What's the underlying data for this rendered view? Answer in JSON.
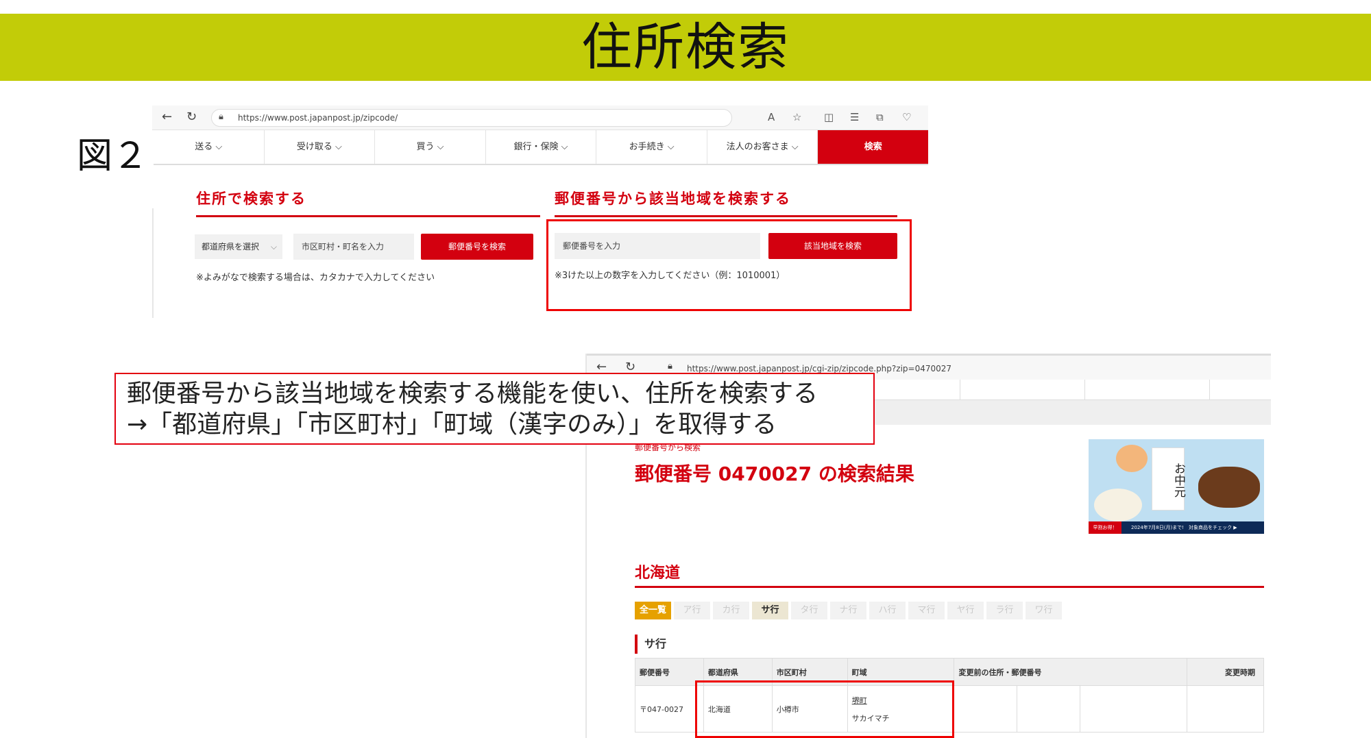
{
  "slide": {
    "title": "住所検索",
    "figure_label": "図２"
  },
  "shot1": {
    "url": "https://www.post.japanpost.jp/zipcode/",
    "nav": [
      "送る ⌵",
      "受け取る ⌵",
      "買う ⌵",
      "銀行・保険 ⌵",
      "お手続き ⌵",
      "法人のお客さま ⌵"
    ],
    "nav_search": "検索",
    "address_section": {
      "title": "住所で検索する",
      "prefecture_select": "都道府県を選択",
      "city_placeholder": "市区町村・町名を入力",
      "button": "郵便番号を検索",
      "note": "※よみがなで検索する場合は、カタカナで入力してください"
    },
    "zip_section": {
      "title": "郵便番号から該当地域を検索する",
      "zip_placeholder": "郵便番号を入力",
      "button": "該当地域を検索",
      "note": "※3けた以上の数字を入力してください（例：1010001）"
    }
  },
  "shot2": {
    "url": "https://www.post.japanpost.jp/cgi-zip/zipcode.php?zip=0470027",
    "breadcrumb": "郵便番号から検索",
    "result_title": "郵便番号 0470027 の検索結果",
    "promo": {
      "card_text": "お中元",
      "strip_left": "早割お得！",
      "strip_text": "2024年7月8日(月)まで!　対象商品をチェック ▶"
    },
    "prefecture_heading": "北海道",
    "kana_tabs": [
      "全一覧",
      "ア行",
      "カ行",
      "サ行",
      "タ行",
      "ナ行",
      "ハ行",
      "マ行",
      "ヤ行",
      "ラ行",
      "ワ行"
    ],
    "active_tab": "サ行",
    "row_group": "サ行",
    "table": {
      "headers": [
        "郵便番号",
        "都道府県",
        "市区町村",
        "町域",
        "変更前の住所・郵便番号",
        "変更時期"
      ],
      "row": {
        "zip": "〒047-0027",
        "prefecture": "北海道",
        "city": "小樽市",
        "town": "堺町",
        "town_kana": "サカイマチ"
      }
    }
  },
  "callout": {
    "line1": "郵便番号から該当地域を検索する機能を使い、住所を検索する",
    "line2": "→「都道府県」「市区町村」「町域（漢字のみ）」を取得する"
  },
  "colors": {
    "banner": "#c2cc08",
    "brand_red": "#d3000f",
    "highlight": "#e00000"
  }
}
